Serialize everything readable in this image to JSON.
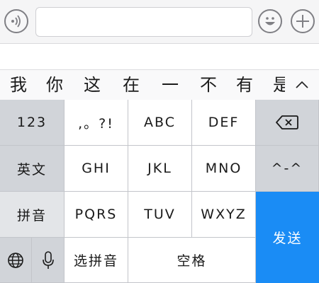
{
  "input_bar": {
    "text_value": "",
    "voice_icon": "voice-wave-icon",
    "emoji_icon": "smiley-face-icon",
    "plus_icon": "plus-icon"
  },
  "candidates": [
    "我",
    "你",
    "这",
    "在",
    "一",
    "不",
    "有",
    "是"
  ],
  "expand_icon": "chevron-up-icon",
  "keyboard": {
    "num_key": "123",
    "english_key": "英文",
    "pinyin_key": "拼音",
    "punct_key": ",。?!",
    "abc": "ABC",
    "def": "DEF",
    "ghi": "GHI",
    "jkl": "JKL",
    "mno": "MNO",
    "pqrs": "PQRS",
    "tuv": "TUV",
    "wxyz": "WXYZ",
    "choose_pinyin": "选拼音",
    "space": "空格",
    "send": "发送",
    "emoticon": "^-^",
    "backspace_icon": "backspace-icon",
    "globe_icon": "globe-icon",
    "mic_icon": "microphone-icon"
  },
  "colors": {
    "send_blue": "#1a8cf5",
    "dark_key": "#d1d4d9",
    "light_key": "#ffffff"
  }
}
